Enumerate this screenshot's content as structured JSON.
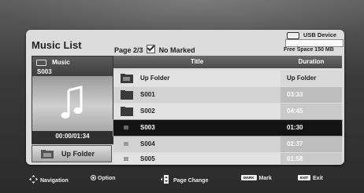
{
  "header": {
    "title": "Music List",
    "page": "Page 2/3",
    "marked": "No Marked",
    "device": "USB Device",
    "free_space": "Free Space 150 MB"
  },
  "preview": {
    "category": "Music",
    "current": "S003",
    "time": "00:00/01:34",
    "up_folder_label": "Up Folder"
  },
  "list": {
    "col_title": "Title",
    "col_duration": "Duration",
    "rows": [
      {
        "title": "Up Folder",
        "duration": "Up Folder",
        "type": "folder"
      },
      {
        "title": "S001",
        "duration": "03:33",
        "type": "folder"
      },
      {
        "title": "S002",
        "duration": "04:45",
        "type": "folder"
      },
      {
        "title": "S003",
        "duration": "01:30",
        "type": "file",
        "selected": true
      },
      {
        "title": "S004",
        "duration": "02:37",
        "type": "file"
      },
      {
        "title": "S005",
        "duration": "01:58",
        "type": "file"
      }
    ]
  },
  "footer": {
    "navigation": "Navigation",
    "option": "Option",
    "page_change": "Page Change",
    "mark_key": "MARK",
    "mark": "Mark",
    "exit_key": "EXIT",
    "exit": "Exit"
  }
}
